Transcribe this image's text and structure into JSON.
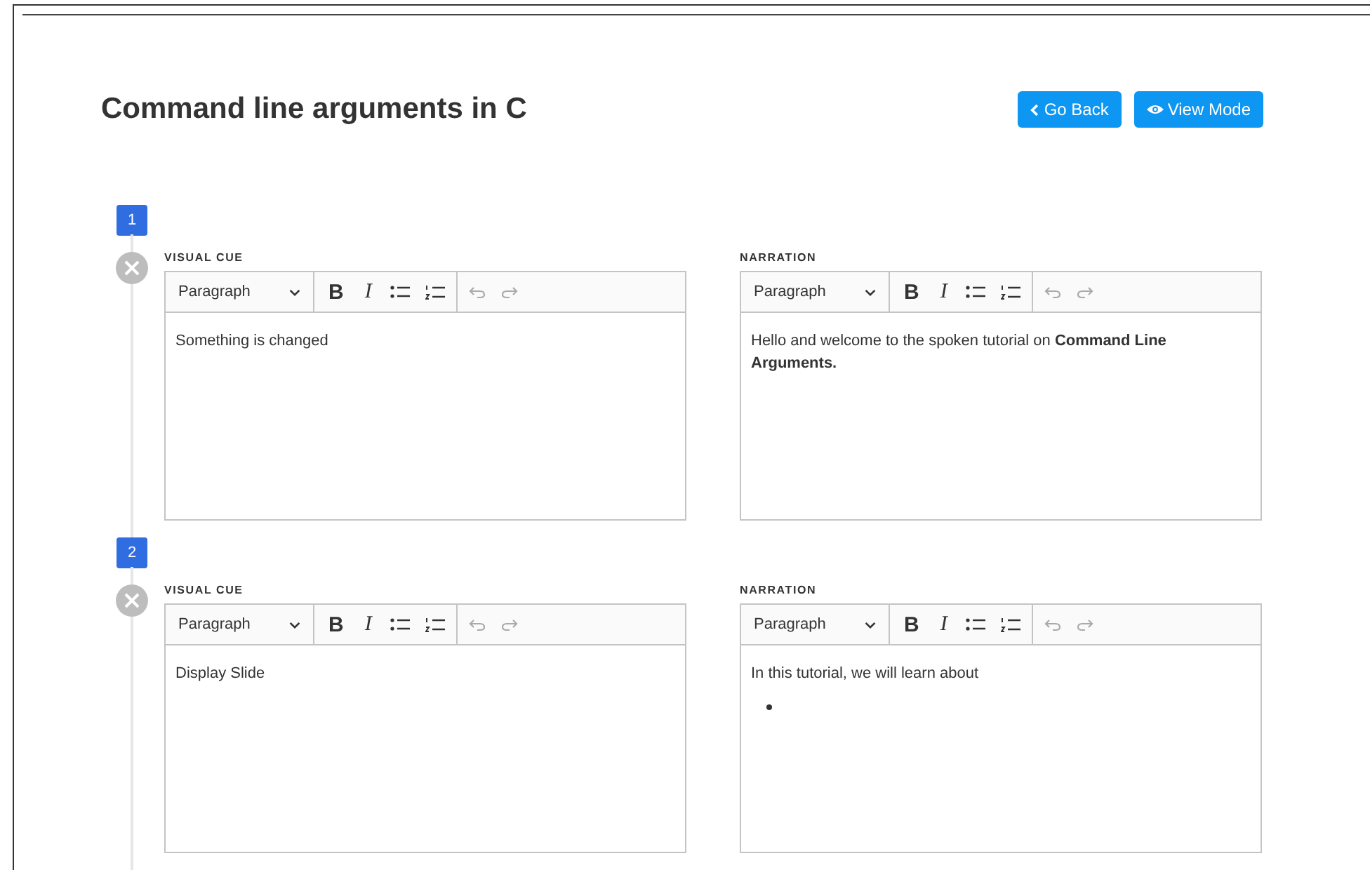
{
  "title": "Command line arguments in C",
  "buttons": [
    {
      "kind": "back",
      "label": "Go Back"
    },
    {
      "kind": "view",
      "label": "View Mode"
    }
  ],
  "steps": [
    {
      "number": "1",
      "editors": [
        {
          "label": "VISUAL CUE",
          "format": "Paragraph",
          "bold": "B",
          "italic": "I",
          "content": [
            {
              "kind": "paragraph",
              "text": "Something is changed"
            }
          ]
        },
        {
          "label": "NARRATION",
          "format": "Paragraph",
          "bold": "B",
          "italic": "I",
          "content": [
            {
              "kind": "paragraph",
              "text": "Hello and welcome to the spoken tutorial on **Command Line Arguments.**"
            }
          ]
        }
      ]
    },
    {
      "number": "2",
      "editors": [
        {
          "label": "VISUAL CUE",
          "format": "Paragraph",
          "bold": "B",
          "italic": "I",
          "content": [
            {
              "kind": "paragraph",
              "text": "Display Slide"
            }
          ]
        },
        {
          "label": "NARRATION",
          "format": "Paragraph",
          "bold": "B",
          "italic": "I",
          "content": [
            {
              "kind": "paragraph",
              "text": "In this tutorial, we will learn about"
            },
            {
              "kind": "empty_bullet"
            }
          ]
        }
      ]
    }
  ]
}
